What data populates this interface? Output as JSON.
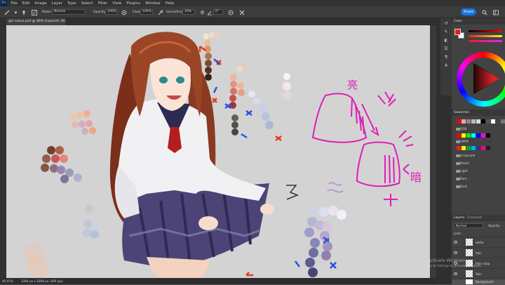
{
  "app": {
    "logo": "Ps"
  },
  "menu": [
    "File",
    "Edit",
    "Image",
    "Layer",
    "Type",
    "Select",
    "Filter",
    "View",
    "Plugins",
    "Window",
    "Help"
  ],
  "options": {
    "mode_label": "Mode:",
    "mode_value": "Normal",
    "opacity_label": "Opacity:",
    "opacity_value": "100%",
    "flow_label": "Flow:",
    "flow_value": "100%",
    "smoothing_label": "Smoothing:",
    "smoothing_value": "10%",
    "angle_value": "0°",
    "share_label": "Share"
  },
  "document": {
    "tab_title": "girl colour.psd @ 46% (Layer24, RGB/8#) *"
  },
  "status": {
    "zoom": "46.01%",
    "doc_size": "3364 px x 1868 px (300 ppi)"
  },
  "panels": {
    "color": {
      "title": "Color",
      "fg_color": "#e81e1e",
      "bg_color": "#ffffff"
    },
    "swatches": {
      "title": "Swatches",
      "recent": [
        "#ff0000",
        "#f0a3a3",
        "#8a8a8a",
        "#bcbcbc",
        "#d9d9d9",
        "#000000",
        "#555555",
        "#ffffff",
        "#444444",
        "#777777",
        "#999999"
      ],
      "groups": [
        {
          "name": "RGB",
          "colors": [
            "#ff0000",
            "#ffff00",
            "#00ff00",
            "#00ffff",
            "#0000ff",
            "#ff00ff",
            "#000000"
          ]
        },
        {
          "name": "CMYK",
          "colors": [
            "#ed1c24",
            "#fff200",
            "#00a651",
            "#00aeef",
            "#2e3192",
            "#ec008c",
            "#231f20"
          ]
        },
        {
          "name": "Grayscale"
        },
        {
          "name": "Pastel"
        },
        {
          "name": "Light"
        },
        {
          "name": "Pure"
        },
        {
          "name": "Dark"
        }
      ]
    },
    "layers": {
      "title": "Layers",
      "tab2": "Channels",
      "blend_mode": "Normal",
      "opacity_label": "Opacity:",
      "lock_label": "Lock:",
      "items": [
        {
          "name": "white"
        },
        {
          "name": "hair"
        },
        {
          "name": "Skin copy"
        },
        {
          "name": "Skin"
        },
        {
          "name": "Background"
        }
      ]
    }
  },
  "watermark": {
    "title": "Activate Windows",
    "subtitle": "Go to Settings to activate Windows."
  },
  "canvas": {
    "note_kanji_1": "亮",
    "note_kanji_2": "暗",
    "ink_color": "#e01fb6",
    "arrow_red": "#e83a1e",
    "arrow_blue": "#2a4fe0"
  }
}
